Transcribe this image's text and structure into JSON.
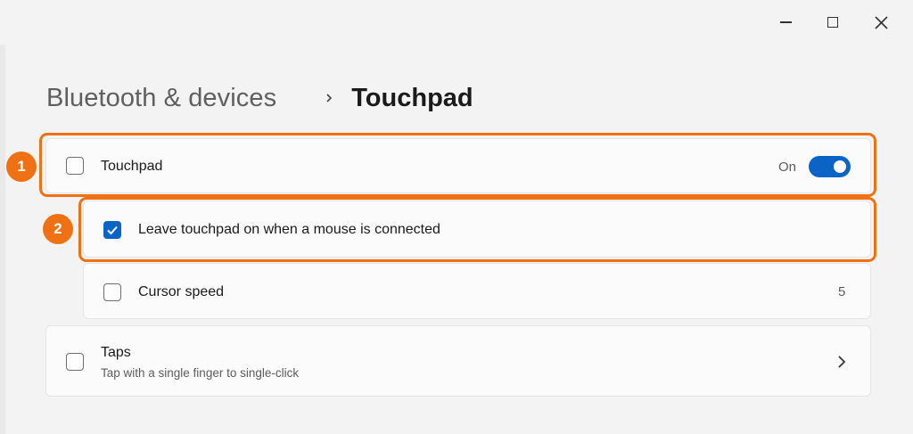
{
  "window": {
    "minimize_icon": "minimize-icon",
    "maximize_icon": "maximize-icon",
    "close_icon": "close-icon"
  },
  "breadcrumb": {
    "parent": "Bluetooth & devices",
    "separator_icon": "chevron-right-icon",
    "current": "Touchpad"
  },
  "settings": {
    "touchpad": {
      "label": "Touchpad",
      "state_text": "On",
      "toggle_on": true,
      "checked": false
    },
    "leave_on": {
      "label": "Leave touchpad on when a mouse is connected",
      "checked": true
    },
    "cursor_speed": {
      "label": "Cursor speed",
      "value": "5",
      "checked": false
    },
    "taps": {
      "label": "Taps",
      "description": "Tap with a single finger to single-click",
      "chevron_icon": "chevron-right-icon",
      "checked": false
    }
  },
  "annotations": {
    "first": "1",
    "second": "2",
    "color": "#f07113"
  },
  "colors": {
    "accent": "#0a64c5",
    "background": "#f3f3f3",
    "card": "#fbfbfb"
  }
}
